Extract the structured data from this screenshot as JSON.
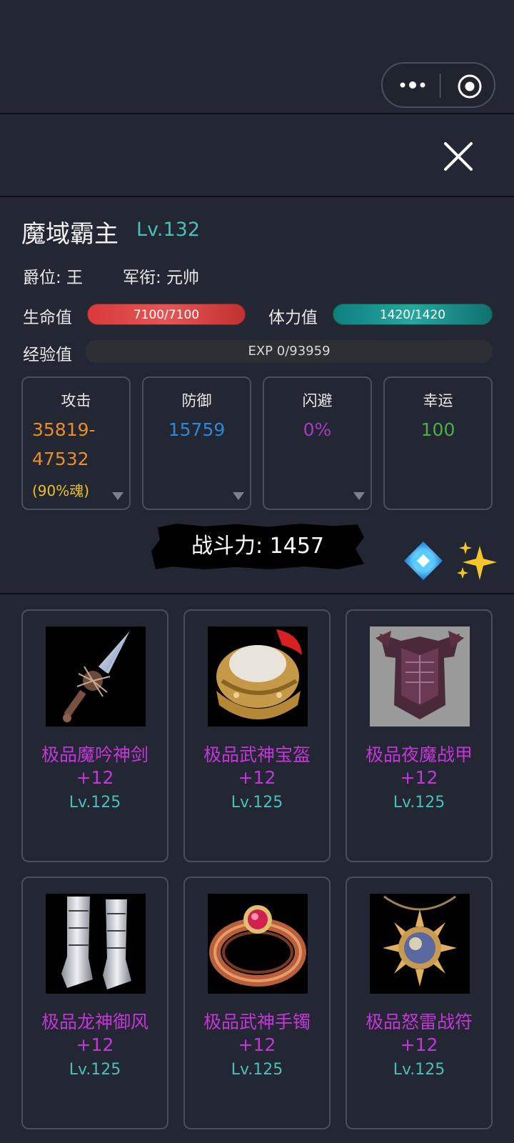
{
  "character": {
    "name": "魔域霸主",
    "level": "Lv.132",
    "rank": "爵位: 王",
    "military": "军衔: 元帅"
  },
  "bars": {
    "hp_label": "生命值",
    "hp_text": "7100/7100",
    "sp_label": "体力值",
    "sp_text": "1420/1420",
    "exp_label": "经验值",
    "exp_text": "EXP 0/93959"
  },
  "stats": {
    "attack": {
      "title": "攻击",
      "line1": "35819-",
      "line2": "47532",
      "line3": "(90%魂)"
    },
    "defense": {
      "title": "防御",
      "value": "15759"
    },
    "dodge": {
      "title": "闪避",
      "value": "0%"
    },
    "luck": {
      "title": "幸运",
      "value": "100"
    }
  },
  "power": {
    "text": "战斗力: 1457"
  },
  "equipment": [
    {
      "name": "极品魔吟神剑",
      "plus": "+12",
      "level": "Lv.125",
      "icon": "sword-icon"
    },
    {
      "name": "极品武神宝盔",
      "plus": "+12",
      "level": "Lv.125",
      "icon": "helmet-icon"
    },
    {
      "name": "极品夜魔战甲",
      "plus": "+12",
      "level": "Lv.125",
      "icon": "armor-icon"
    },
    {
      "name": "极品龙神御风",
      "plus": "+12",
      "level": "Lv.125",
      "icon": "boots-icon"
    },
    {
      "name": "极品武神手镯",
      "plus": "+12",
      "level": "Lv.125",
      "icon": "bracelet-icon"
    },
    {
      "name": "极品怒雷战符",
      "plus": "+12",
      "level": "Lv.125",
      "icon": "amulet-icon"
    }
  ],
  "colors": {
    "background": "#232733",
    "level_teal": "#49bfb8",
    "equip_purple": "#c436d8",
    "attack_orange": "#e88d2a",
    "defense_blue": "#2f87d8",
    "dodge_purple": "#a33ac0",
    "luck_green": "#4fae4a"
  }
}
